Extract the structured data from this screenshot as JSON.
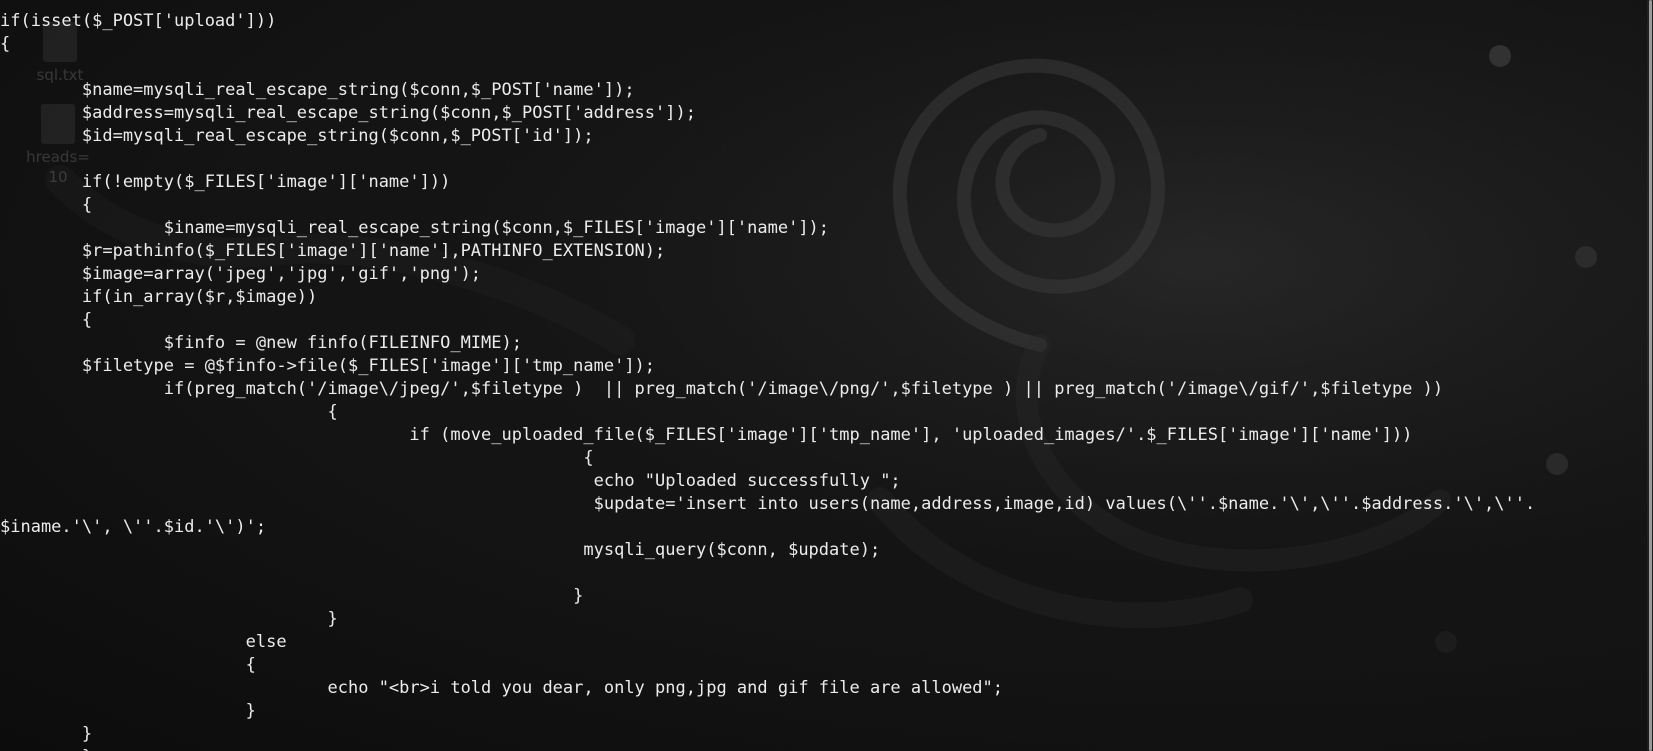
{
  "desktop": {
    "icons": [
      {
        "name": "file-icon",
        "label": "sql.txt",
        "sublabel": ""
      },
      {
        "name": "file-icon",
        "label": "hreads=",
        "sublabel": "10"
      }
    ]
  },
  "terminal": {
    "lines": [
      "if(isset($_POST['upload']))",
      "{",
      "",
      "        $name=mysqli_real_escape_string($conn,$_POST['name']);",
      "        $address=mysqli_real_escape_string($conn,$_POST['address']);",
      "        $id=mysqli_real_escape_string($conn,$_POST['id']);",
      "",
      "        if(!empty($_FILES['image']['name']))",
      "        {",
      "                $iname=mysqli_real_escape_string($conn,$_FILES['image']['name']);",
      "        $r=pathinfo($_FILES['image']['name'],PATHINFO_EXTENSION);",
      "        $image=array('jpeg','jpg','gif','png');",
      "        if(in_array($r,$image))",
      "        {",
      "                $finfo = @new finfo(FILEINFO_MIME);",
      "        $filetype = @$finfo->file($_FILES['image']['tmp_name']);",
      "                if(preg_match('/image\\/jpeg/',$filetype )  || preg_match('/image\\/png/',$filetype ) || preg_match('/image\\/gif/',$filetype ))",
      "                                {",
      "                                        if (move_uploaded_file($_FILES['image']['tmp_name'], 'uploaded_images/'.$_FILES['image']['name']))",
      "                                                         {",
      "                                                          echo \"Uploaded successfully \";",
      "                                                          $update='insert into users(name,address,image,id) values(\\''.$name.'\\',\\''.$address.'\\',\\''.",
      "$iname.'\\', \\''.$id.'\\')';",
      "                                                         mysqli_query($conn, $update);",
      "",
      "                                                        }",
      "                                }",
      "                        else",
      "                        {",
      "                                echo \"<br>i told you dear, only png,jpg and gif file are allowed\";",
      "                        }",
      "        }",
      "        }"
    ]
  }
}
